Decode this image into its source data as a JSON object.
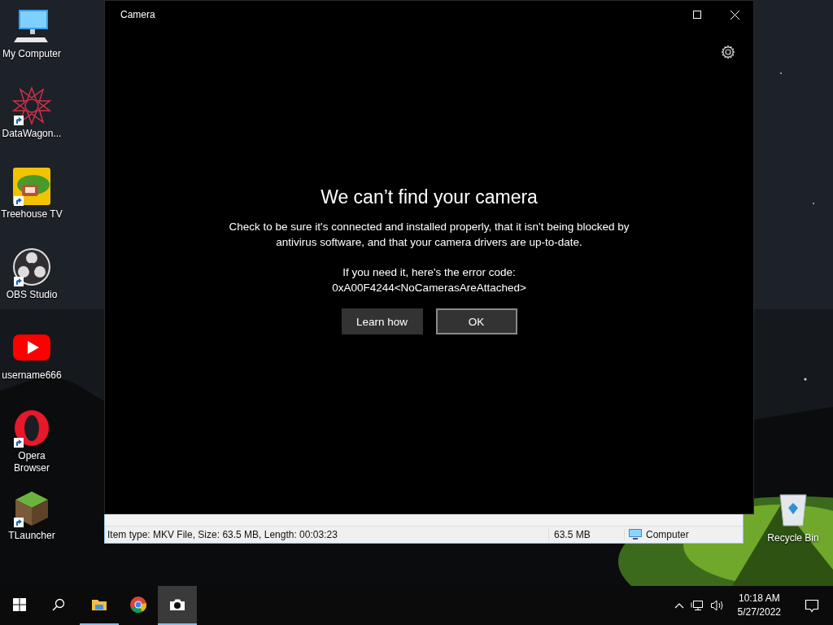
{
  "desktop": {
    "icons": [
      {
        "label": "My Computer",
        "kind": "computer",
        "shortcut": false
      },
      {
        "label": "DataWagon...",
        "kind": "knot",
        "shortcut": true
      },
      {
        "label": "Treehouse TV",
        "kind": "treehouse",
        "shortcut": true
      },
      {
        "label": "OBS Studio",
        "kind": "obs",
        "shortcut": true
      },
      {
        "label": "username666",
        "kind": "play",
        "shortcut": false
      },
      {
        "label": "Opera Browser",
        "kind": "opera",
        "shortcut": true
      },
      {
        "label": "TLauncher",
        "kind": "block",
        "shortcut": true
      }
    ],
    "recycle_bin": {
      "label": "Recycle Bin"
    }
  },
  "explorer_window": {
    "status_bar": {
      "details": "Item type: MKV File, Size: 63.5 MB, Length: 00:03:23",
      "size": "63.5 MB",
      "location": "Computer"
    }
  },
  "camera_window": {
    "title": "Camera",
    "heading": "We can’t find your camera",
    "message": "Check to be sure it's connected and installed properly, that it isn't being blocked by antivirus software, and that your camera drivers are up-to-date.",
    "code_intro": "If you need it, here's the error code:",
    "code": "0xA00F4244<NoCamerasAreAttached>",
    "buttons": [
      {
        "label": "Learn how",
        "kind": "secondary"
      },
      {
        "label": "OK",
        "kind": "primary"
      }
    ]
  },
  "taskbar": {
    "apps": [
      {
        "kind": "folder",
        "running": true,
        "selected": false
      },
      {
        "kind": "chrome",
        "running": false,
        "selected": false
      },
      {
        "kind": "camera",
        "running": true,
        "selected": true
      }
    ],
    "clock": {
      "time": "10:18 AM",
      "date": "5/27/2022"
    }
  }
}
